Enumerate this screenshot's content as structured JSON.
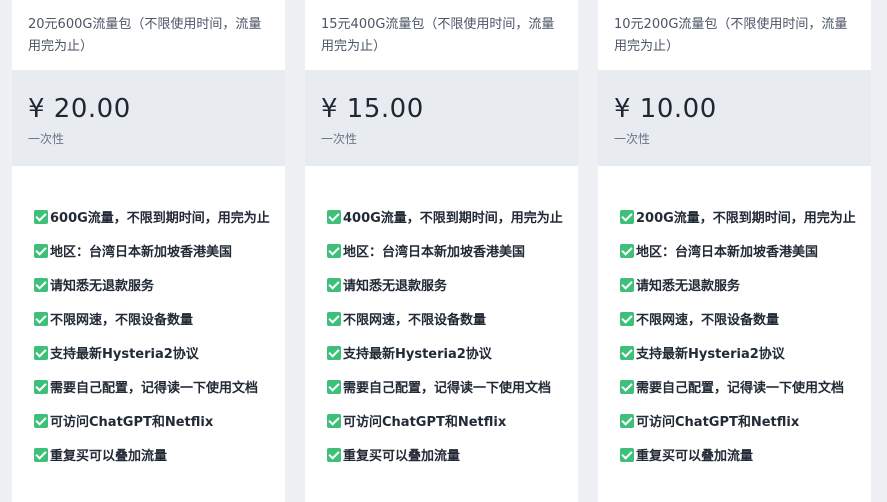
{
  "plans": [
    {
      "title": "20元600G流量包（不限使用时间，流量用完为止）",
      "price": "¥ 20.00",
      "period": "一次性",
      "features": [
        "600G流量，不限到期时间，用完为止",
        "地区：台湾日本新加坡香港美国",
        "请知悉无退款服务",
        "不限网速，不限设备数量",
        "支持最新Hysteria2协议",
        "需要自己配置，记得读一下使用文档",
        "可访问ChatGPT和Netflix",
        "重复买可以叠加流量"
      ]
    },
    {
      "title": "15元400G流量包（不限使用时间，流量用完为止）",
      "price": "¥ 15.00",
      "period": "一次性",
      "features": [
        "400G流量，不限到期时间，用完为止",
        "地区：台湾日本新加坡香港美国",
        "请知悉无退款服务",
        "不限网速，不限设备数量",
        "支持最新Hysteria2协议",
        "需要自己配置，记得读一下使用文档",
        "可访问ChatGPT和Netflix",
        "重复买可以叠加流量"
      ]
    },
    {
      "title": "10元200G流量包（不限使用时间，流量用完为止）",
      "price": "¥ 10.00",
      "period": "一次性",
      "features": [
        "200G流量，不限到期时间，用完为止",
        "地区：台湾日本新加坡香港美国",
        "请知悉无退款服务",
        "不限网速，不限设备数量",
        "支持最新Hysteria2协议",
        "需要自己配置，记得读一下使用文档",
        "可访问ChatGPT和Netflix",
        "重复买可以叠加流量"
      ]
    }
  ],
  "colors": {
    "check": "#3ec07a",
    "price_band": "#e8ebef",
    "page_bg": "#eef0f3"
  }
}
